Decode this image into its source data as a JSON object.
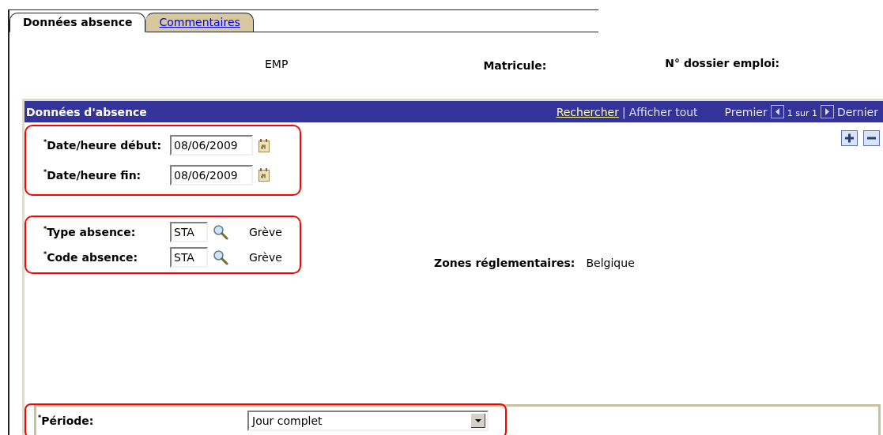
{
  "tabs": [
    {
      "label": "Données absence",
      "selected": true
    },
    {
      "label": "Commentaires",
      "selected": false
    }
  ],
  "header": {
    "employee": "EMP",
    "matricule_label": "Matricule:",
    "dossier_label": "N° dossier emploi:"
  },
  "section": {
    "title": "Données d'absence",
    "search_link": "Rechercher",
    "separator": "|",
    "show_all": "Afficher tout",
    "first": "Premier",
    "counter": "1 sur 1",
    "last": "Dernier"
  },
  "dates": [
    {
      "label": "$^{*}$Date/heure début:",
      "value": "08/06/2009"
    },
    {
      "label": "$^{*}$Date/heure fin:",
      "value": "08/06/2009"
    }
  ],
  "codes": [
    {
      "label": "$^{*}$Type absence:",
      "value": "STA",
      "description": "Grève"
    },
    {
      "label": "$^{*}$Code absence:",
      "value": "STA",
      "description": "Grève"
    }
  ],
  "zones": {
    "label": "Zones réglementaires:",
    "value": "Belgique"
  },
  "periode": {
    "label": "$^{*}$Période:",
    "value": "Jour complet"
  }
}
